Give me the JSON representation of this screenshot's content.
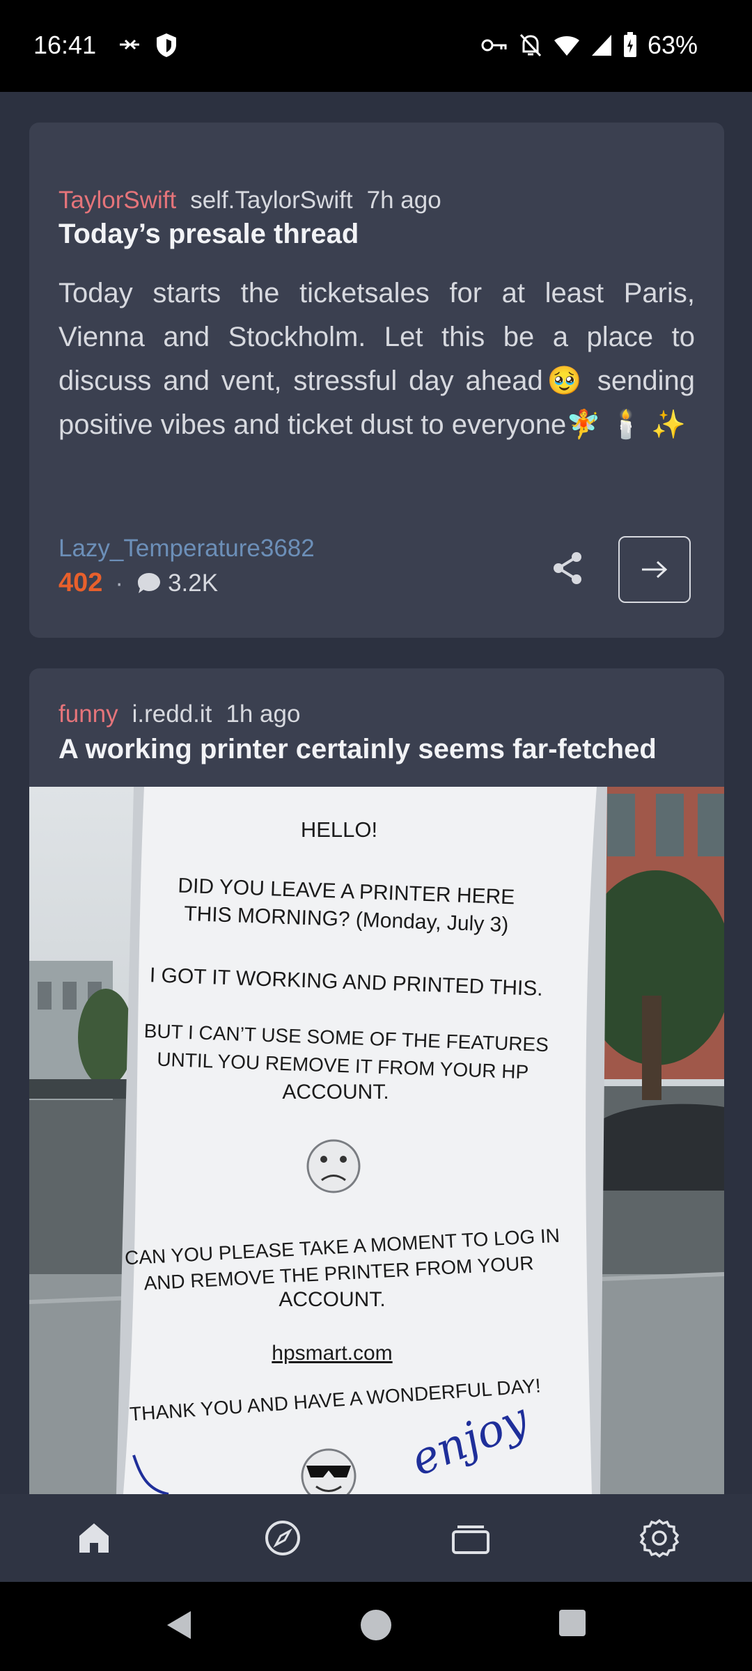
{
  "status_bar": {
    "time": "16:41",
    "battery": "63%"
  },
  "posts": [
    {
      "subreddit": "TaylorSwift",
      "domain": "self.TaylorSwift",
      "age": "7h ago",
      "title": "Today’s presale thread",
      "body": "Today starts the ticketsales for at least Paris, Vienna and Stockholm. Let this be a place to discuss and vent, stressful day ahead🥹 sending positive vibes and ticket dust to everyone🧚 🕯️ ✨",
      "author": "Lazy_Temperature3682",
      "score": "402",
      "comments": "3.2K"
    },
    {
      "subreddit": "funny",
      "domain": "i.redd.it",
      "age": "1h ago",
      "title": "A working printer certainly seems far-fetched",
      "image_text": {
        "hello": "HELLO!",
        "line1": "DID YOU LEAVE A PRINTER HERE",
        "line2": "THIS MORNING? (Monday, July 3)",
        "line3": "I GOT IT WORKING AND PRINTED THIS.",
        "line4": "BUT I CAN’T USE SOME OF THE FEATURES",
        "line5": "UNTIL YOU REMOVE IT FROM YOUR HP",
        "line6": "ACCOUNT.",
        "line7": "CAN YOU PLEASE TAKE A MOMENT TO LOG IN",
        "line8": "AND REMOVE THE PRINTER FROM YOUR",
        "line9": "ACCOUNT.",
        "link": "hpsmart.com",
        "thanks": "THANK YOU AND HAVE A WONDERFUL DAY!",
        "handwriting": "enjoy"
      }
    }
  ],
  "bottom_nav": [
    "home-icon",
    "explore-icon",
    "inbox-icon",
    "settings-icon"
  ],
  "colors": {
    "background": "#2c3140",
    "card": "#3b4050",
    "subreddit": "#e5747a",
    "score": "#e8602c",
    "author": "#6c8fb8"
  }
}
